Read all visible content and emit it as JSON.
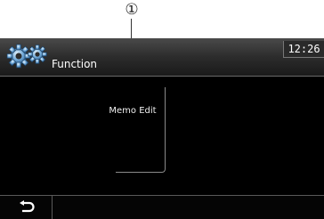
{
  "callout": {
    "number": "①"
  },
  "header": {
    "title": "Function",
    "icon": "gears-icon",
    "clock": "12:26"
  },
  "menu": {
    "items": [
      {
        "label": "Memo Edit"
      }
    ]
  },
  "footer": {
    "back_icon": "back-arrow-icon"
  },
  "colors": {
    "screen_bg": "#000000",
    "text": "#ffffff",
    "header_gradient_top": "#4a4a4a",
    "border_gray": "#8a8a8a"
  }
}
